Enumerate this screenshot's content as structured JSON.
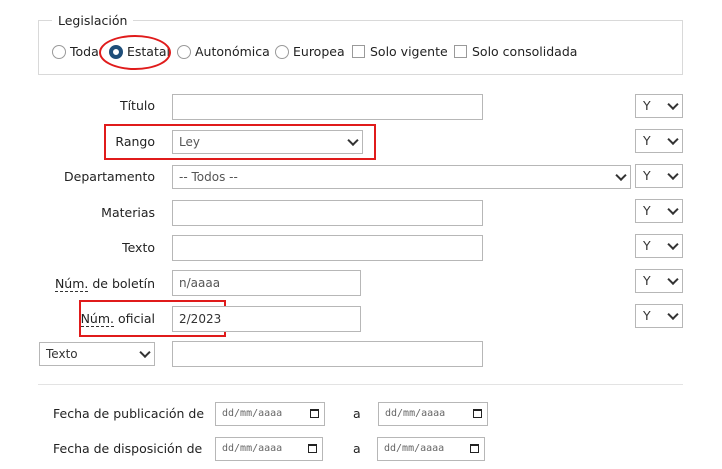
{
  "legislacion": {
    "legend": "Legislación",
    "options": [
      "Toda",
      "Estatal",
      "Autonómica",
      "Europea"
    ],
    "selected": "Estatal",
    "checkboxes": [
      "Solo vigente",
      "Solo consolidada"
    ]
  },
  "fields": {
    "titulo": {
      "label": "Título",
      "value": ""
    },
    "rango": {
      "label": "Rango",
      "value": "Ley"
    },
    "departamento": {
      "label": "Departamento",
      "value": "-- Todos --"
    },
    "materias": {
      "label": "Materias",
      "value": ""
    },
    "texto": {
      "label": "Texto",
      "value": ""
    },
    "num_boletin": {
      "label_abbr": "Núm.",
      "label_rest": " de boletín",
      "placeholder": "n/aaaa",
      "value": ""
    },
    "num_oficial": {
      "label_abbr": "Núm.",
      "label_rest": " oficial",
      "value": "2/2023"
    },
    "extra": {
      "select_value": "Texto",
      "value": ""
    }
  },
  "operator": "Y",
  "dates": {
    "publicacion": {
      "label": "Fecha de publicación de",
      "from_placeholder": "dd/mm/aaaa",
      "sep": "a",
      "to_placeholder": "dd/mm/aaaa"
    },
    "disposicion": {
      "label": "Fecha de disposición de",
      "from_placeholder": "dd/mm/aaaa",
      "sep": "a",
      "to_placeholder": "dd/mm/aaaa"
    }
  },
  "colors": {
    "highlight": "#e01b1b",
    "radio_checked": "#1f4e79"
  }
}
